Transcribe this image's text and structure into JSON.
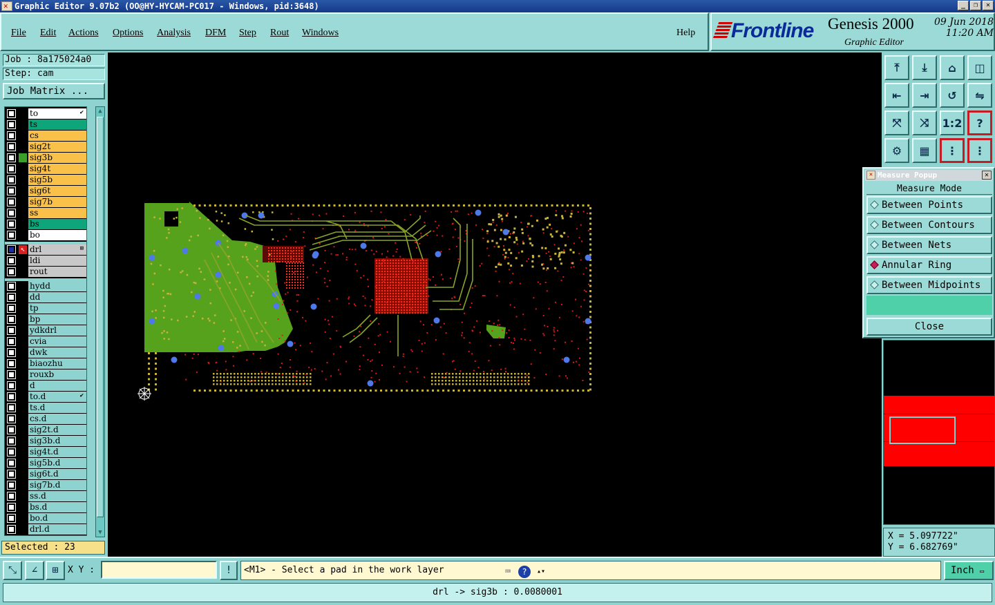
{
  "window": {
    "title": "Graphic Editor 9.07b2  (OO@HY-HYCAM-PC017 - Windows, pid:3648)",
    "min": "_",
    "max": "❐",
    "close": "✕"
  },
  "menu": [
    "File",
    "Edit",
    "Actions",
    "Options",
    "Analysis",
    "DFM",
    "Step",
    "Rout",
    "Windows"
  ],
  "help": "Help",
  "brand": {
    "logo": "Frontline",
    "product": "Genesis 2000",
    "subtitle": "Graphic Editor",
    "date": "09 Jun 2018",
    "time": "11:20 AM"
  },
  "job": {
    "line": "Job : 8a175024a0",
    "step": "Step: cam",
    "matrix_button": "Job Matrix ..."
  },
  "layers_board": [
    {
      "name": "to",
      "color": "#ffffff",
      "tick": true
    },
    {
      "name": "ts",
      "color": "#0fa57a"
    },
    {
      "name": "cs",
      "color": "#f9c14a"
    },
    {
      "name": "sig2t",
      "color": "#f9c14a"
    },
    {
      "name": "sig3b",
      "color": "#f9c14a",
      "dot": "#3aa02a"
    },
    {
      "name": "sig4t",
      "color": "#f9c14a"
    },
    {
      "name": "sig5b",
      "color": "#f9c14a"
    },
    {
      "name": "sig6t",
      "color": "#f9c14a"
    },
    {
      "name": "sig7b",
      "color": "#f9c14a"
    },
    {
      "name": "ss",
      "color": "#f9c14a"
    },
    {
      "name": "bs",
      "color": "#0fa57a"
    },
    {
      "name": "bo",
      "color": "#ffffff"
    }
  ],
  "layers_drill": [
    {
      "name": "drl",
      "color": "#c8c8c8",
      "work": true
    },
    {
      "name": "ldi",
      "color": "#c8c8c8"
    },
    {
      "name": "rout",
      "color": "#c8c8c8"
    }
  ],
  "layers_misc": [
    {
      "name": "hydd"
    },
    {
      "name": "dd"
    },
    {
      "name": "tp"
    },
    {
      "name": "bp"
    },
    {
      "name": "ydkdrl"
    },
    {
      "name": "cvia"
    },
    {
      "name": "dwk"
    },
    {
      "name": "biaozhu"
    },
    {
      "name": "rouxb"
    },
    {
      "name": "d"
    },
    {
      "name": "to.d",
      "tick": true
    },
    {
      "name": "ts.d"
    },
    {
      "name": "cs.d"
    },
    {
      "name": "sig2t.d"
    },
    {
      "name": "sig3b.d"
    },
    {
      "name": "sig4t.d"
    },
    {
      "name": "sig5b.d"
    },
    {
      "name": "sig6t.d"
    },
    {
      "name": "sig7b.d"
    },
    {
      "name": "ss.d"
    },
    {
      "name": "bs.d"
    },
    {
      "name": "bo.d"
    },
    {
      "name": "drl.d"
    }
  ],
  "selected": "Selected : 23",
  "toolbar_icons": [
    "zoom-home-icon",
    "zoom-back-icon",
    "home-icon",
    "window-split-icon",
    "pan-left-icon",
    "pan-right-icon",
    "rotate-icon",
    "mirror-icon",
    "fit-all-icon",
    "fit-profile-icon",
    "scale-1-2-icon",
    "query-icon",
    "tools-icon",
    "grid-icon",
    "layers-a-icon",
    "layers-b-icon"
  ],
  "measure": {
    "title": "Measure Popup",
    "mode_label": "Measure Mode",
    "options": [
      {
        "label": "Between Points",
        "selected": false
      },
      {
        "label": "Between Contours",
        "selected": false
      },
      {
        "label": "Between Nets",
        "selected": false
      },
      {
        "label": "Annular Ring",
        "selected": true
      },
      {
        "label": "Between Midpoints",
        "selected": false
      }
    ],
    "close": "Close"
  },
  "coords": {
    "x": "X = 5.097722\"",
    "y": "Y = 6.682769\""
  },
  "status": {
    "xy_label": "X Y :",
    "xy_value": "",
    "prompt": "<M1> - Select a pad in the work layer",
    "units": "Inch",
    "message": "drl -> sig3b : 0.0080001"
  },
  "colors": {
    "copper_green": "#57a21d",
    "trace_red": "#e01818",
    "pad_yellow": "#c8b43a",
    "via_blue": "#4f78e8",
    "trace_olive": "#8aa428",
    "panel_cyan": "#8fd3d0"
  }
}
